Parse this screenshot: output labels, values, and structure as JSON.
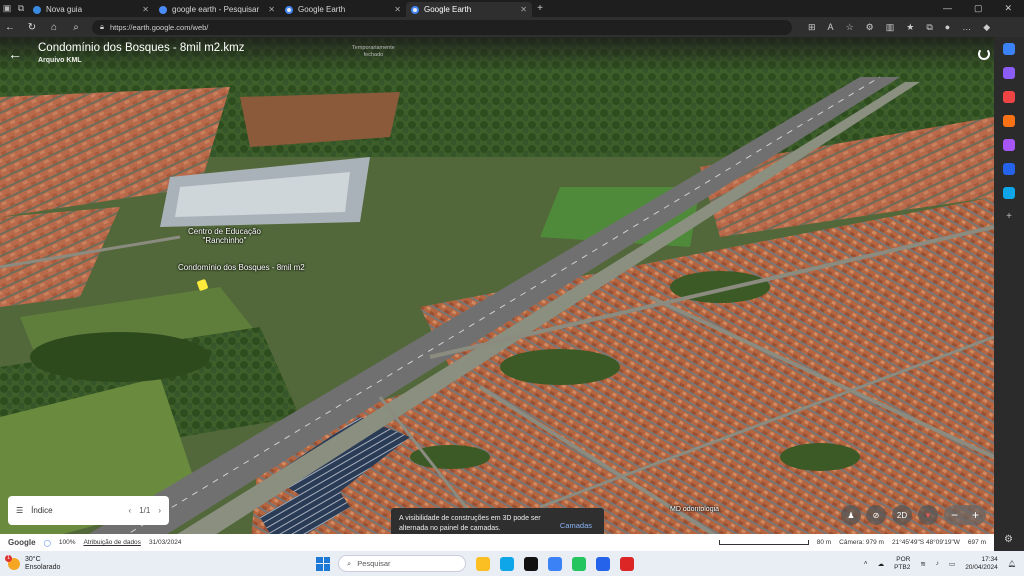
{
  "browser": {
    "tabs": [
      {
        "label": "Nova guia"
      },
      {
        "label": "google earth - Pesquisar"
      },
      {
        "label": "Google Earth"
      },
      {
        "label": "Google Earth"
      }
    ],
    "url": "https://earth.google.com/web/"
  },
  "earth": {
    "title": "Condomínio dos Bosques - 8mil m2.kmz",
    "subtitle": "Arquivo KML",
    "closed_label_1": "Temporariamente",
    "closed_label_2": "fechado",
    "place_label_1": "Centro de Educação",
    "place_label_2": "\"Ranchinho\"",
    "pin_label": "Condomínio dos Bosques - 8mil m2",
    "poi_label": "MD odontologia",
    "index_label": "Índice",
    "index_page": "1/1",
    "toast_text": "A visibilidade de construções em 3D pode ser alternada no painel de camadas.",
    "toast_action": "Camadas",
    "mode_2d": "2D",
    "footer": {
      "brand": "Google",
      "zoom": "100%",
      "attribution": "Atribuição de dados",
      "date": "31/03/2024",
      "scale": "80 m",
      "camera": "Câmera: 979 m",
      "coords": "21°45'49\"S 48°09'19\"W",
      "elev": "697 m"
    }
  },
  "taskbar": {
    "temp": "30°C",
    "weather": "Ensolarado",
    "weather_badge": "1",
    "search_placeholder": "Pesquisar",
    "lang1": "POR",
    "lang2": "PTB2",
    "time": "17:34",
    "date": "20/04/2024"
  }
}
